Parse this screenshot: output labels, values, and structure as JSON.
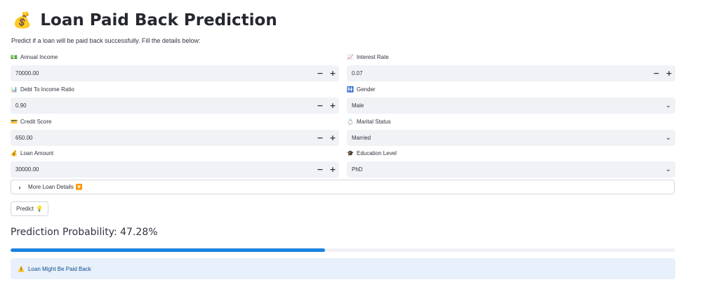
{
  "header": {
    "icon": "money-bag-icon",
    "icon_glyph": "💰",
    "title": "Loan Paid Back Prediction",
    "subtitle": "Predict if a loan will be paid back successfully. Fill the details below:"
  },
  "form": {
    "annual_income": {
      "icon": "💵",
      "label": "Annual Income",
      "value": "70000.00"
    },
    "interest_rate": {
      "icon": "📈",
      "label": "Interest Rate",
      "value": "0.07"
    },
    "debt_to_income": {
      "icon": "📊",
      "label": "Debt To Income Ratio",
      "value": "0.90"
    },
    "gender": {
      "icon": "🚻",
      "label": "Gender",
      "value": "Male"
    },
    "credit_score": {
      "icon": "💳",
      "label": "Credit Score",
      "value": "650.00"
    },
    "marital_status": {
      "icon": "💍",
      "label": "Marital Status",
      "value": "Married"
    },
    "loan_amount": {
      "icon": "💰",
      "label": "Loan Amount",
      "value": "30000.00"
    },
    "education_level": {
      "icon": "🎓",
      "label": "Education Level",
      "value": "PhD"
    },
    "stepper_minus": "−",
    "stepper_plus": "+"
  },
  "expander": {
    "label": "More Loan Details",
    "icon": "🔽"
  },
  "predict_button": {
    "label": "Predict",
    "icon": "💡"
  },
  "result": {
    "heading": "Prediction Probability: 47.28%",
    "probability_percent": 47.28,
    "alert_icon": "⚠️",
    "alert_text": "Loan Might Be Paid Back"
  },
  "colors": {
    "progress_fill": "#1c83e1",
    "alert_bg": "#e8f0fb",
    "alert_text": "#0e4d8a",
    "input_bg": "#f0f2f6"
  }
}
